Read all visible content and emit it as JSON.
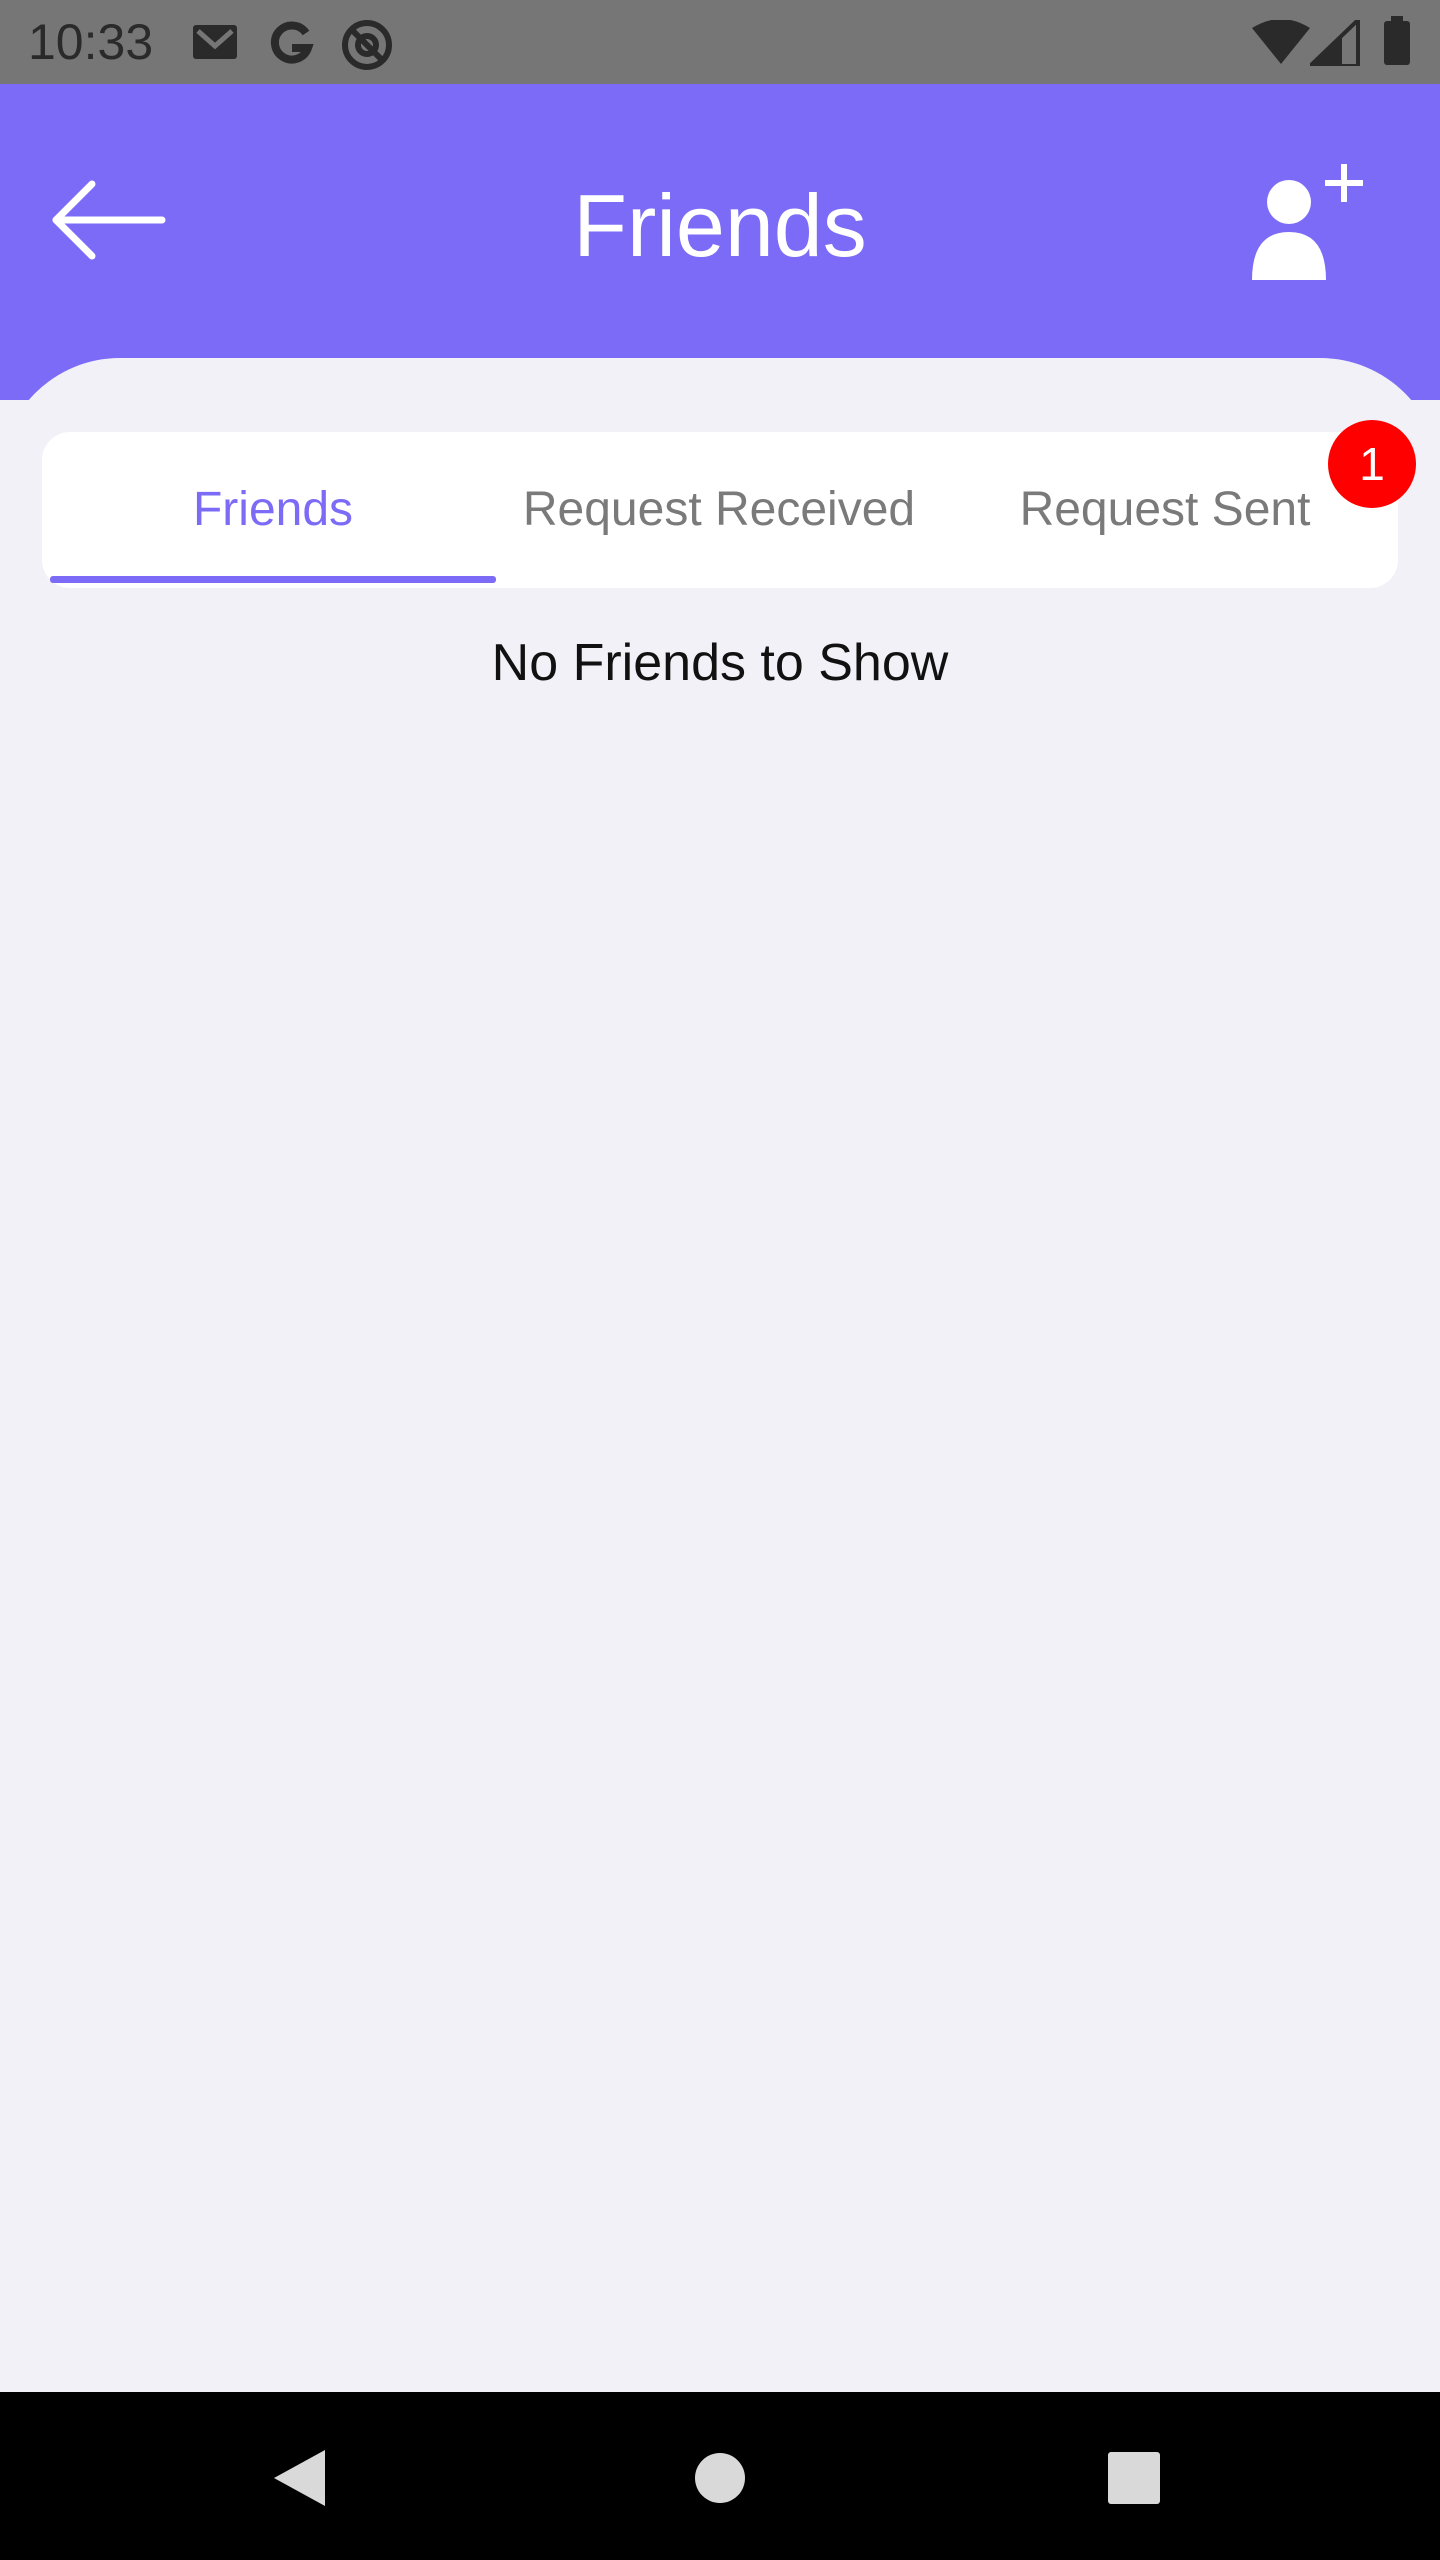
{
  "status_bar": {
    "time": "10:33",
    "left_icons": [
      "gmail-icon",
      "google-icon",
      "at-sign-icon"
    ],
    "right_icons": [
      "wifi-icon",
      "cellular-signal-icon",
      "battery-icon"
    ]
  },
  "header": {
    "title": "Friends",
    "back_icon": "arrow-left-icon",
    "action_icon": "add-person-icon",
    "background_color": "#7b6bf7"
  },
  "tabs": [
    {
      "label": "Friends",
      "active": true
    },
    {
      "label": "Request Received",
      "active": false
    },
    {
      "label": "Request Sent",
      "active": false
    }
  ],
  "badge": {
    "count": "1",
    "color": "#ff0000"
  },
  "empty_state": {
    "message": "No Friends to Show"
  },
  "nav_bar": {
    "icons": [
      "nav-back-icon",
      "nav-home-icon",
      "nav-recents-icon"
    ]
  }
}
